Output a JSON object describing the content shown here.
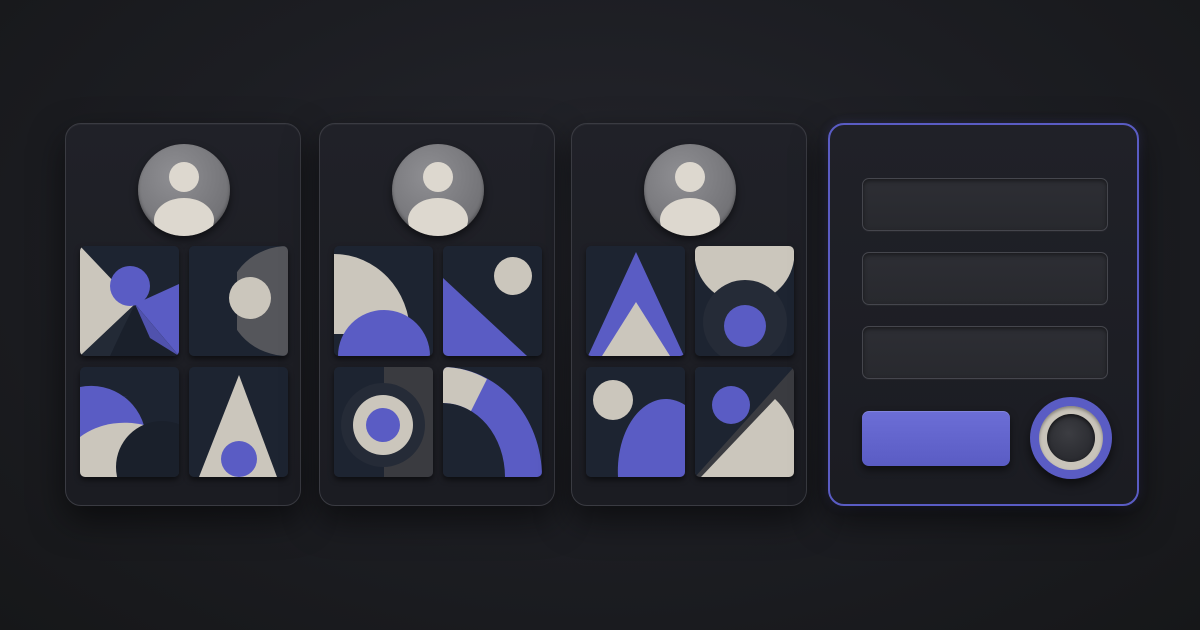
{
  "colors": {
    "background": "#1c1d22",
    "card": "#1f2026",
    "tile_navy": "#1d2431",
    "tile_charcoal": "#3a3b40",
    "beige": "#cbc6bc",
    "indigo": "#5a5cc4",
    "avatar_gray": "#7a7a7e"
  },
  "icons": {
    "avatar": "user-avatar-icon",
    "toggle": "record-toggle-icon"
  },
  "cards": [
    {
      "type": "profile",
      "tiles": [
        "bowtie-circle",
        "half-circle-moon",
        "overlapping-arcs",
        "triangle-dot"
      ]
    },
    {
      "type": "profile",
      "tiles": [
        "quarter-circles",
        "triangle-sun",
        "target-rings",
        "rainbow-arc"
      ]
    },
    {
      "type": "profile",
      "tiles": [
        "triangle-peak",
        "semicircle-ring",
        "circle-dome",
        "diagonal-split"
      ]
    },
    {
      "type": "form",
      "fields": 3,
      "buttons": [
        "primary",
        "round"
      ]
    }
  ],
  "form": {
    "field_1_value": "",
    "field_2_value": "",
    "field_3_value": "",
    "primary_button_label": ""
  }
}
